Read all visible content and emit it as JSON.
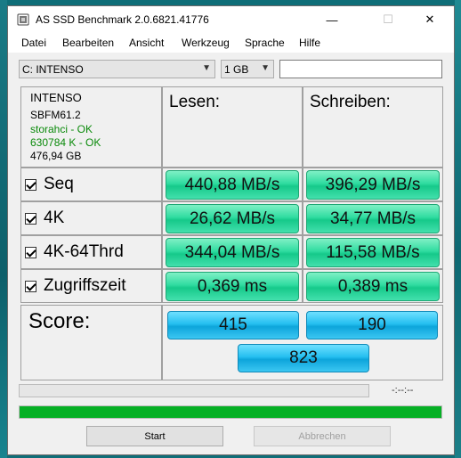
{
  "window": {
    "title": "AS SSD Benchmark 2.0.6821.41776"
  },
  "controls": {
    "minimize": "—",
    "maximize": "☐",
    "close": "✕"
  },
  "menu": [
    "Datei",
    "Bearbeiten",
    "Ansicht",
    "Werkzeug",
    "Sprache",
    "Hilfe"
  ],
  "toolbar": {
    "drive": "C: INTENSO",
    "size": "1 GB",
    "extra": ""
  },
  "drive_info": {
    "name": "INTENSO",
    "firmware": "SBFM61.2",
    "driver": "storahci - OK",
    "alignment": "630784 K - OK",
    "capacity": "476,94 GB"
  },
  "headers": {
    "read": "Lesen:",
    "write": "Schreiben:"
  },
  "rows": [
    {
      "label": "Seq",
      "read": "440,88 MB/s",
      "write": "396,29 MB/s"
    },
    {
      "label": "4K",
      "read": "26,62 MB/s",
      "write": "34,77 MB/s"
    },
    {
      "label": "4K-64Thrd",
      "read": "344,04 MB/s",
      "write": "115,58 MB/s"
    },
    {
      "label": "Zugriffszeit",
      "read": "0,369 ms",
      "write": "0,389 ms"
    }
  ],
  "score": {
    "label": "Score:",
    "read": "415",
    "write": "190",
    "total": "823"
  },
  "progress": {
    "time": "-:--:--",
    "top_fraction": 0,
    "bottom_fraction": 1
  },
  "buttons": {
    "start": "Start",
    "abort": "Abbrechen"
  },
  "colors": {
    "value_green": "#16c98a",
    "score_blue": "#0da5db",
    "progress_green": "#06b025"
  }
}
